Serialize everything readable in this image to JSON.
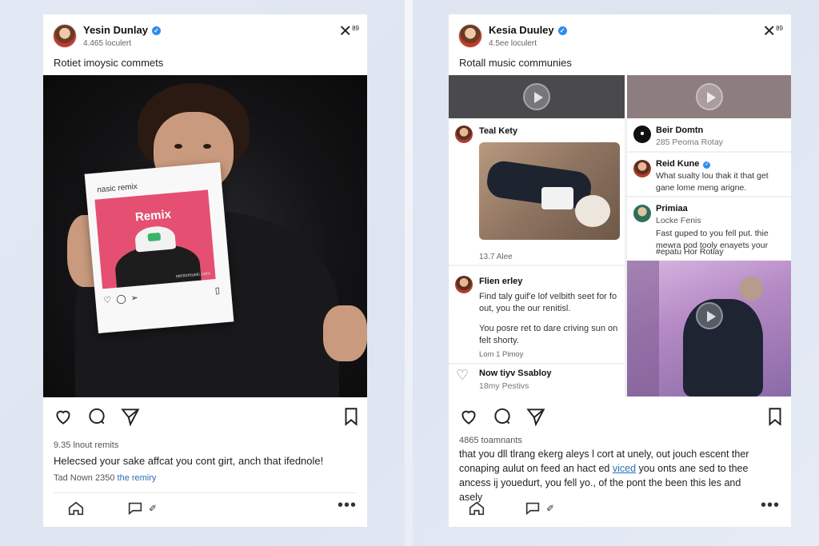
{
  "left_post": {
    "username": "Yesin Dunlay",
    "followers": "4.465 loculert",
    "caption": "Rotiet imoysic commets",
    "polaroid_title": "nasic remix",
    "remix_label": "Remix",
    "remix_small": "remixmusic.com",
    "likes": "9.35 lnout remits",
    "description": "Helecsed your sake affcat you cont girt, anch that ifednole!",
    "tag_text": "Tad Nown 2350",
    "tag_link": "the remiry",
    "close_sup": "89"
  },
  "right_post": {
    "username": "Kesia Duuley",
    "followers": "4.5ee loculert",
    "caption": "Rotall music communies",
    "close_sup": "89",
    "cards": {
      "teal": {
        "name": "Teal Kety",
        "footer": "13.7 Alee"
      },
      "beir": {
        "name": "Beir Domtn",
        "sub": "285 Peoma Rotay"
      },
      "reid": {
        "name": "Reid Kune",
        "text": "What sualty lou thak it that get gane lome meng arigne."
      },
      "primiaa": {
        "name": "Primiaa",
        "sub": "Locke Fenis",
        "text": "Fast guped to you fell put. thie mewra pod tooly enayets your",
        "hashtag": "#epatu Hor Rotiay"
      },
      "flien": {
        "name": "Flien erley",
        "text1": "Find taly guif'e lof velbith seet for fo out, you the our renitisl.",
        "text2": "You posre ret to dare criving sun on felt shorty.",
        "footer": "Lom 1 Pimoy"
      },
      "now": {
        "name": "Now tiyv Ssabloy",
        "sub": "18my Pestivs"
      }
    },
    "likes": "4865 toamnants",
    "desc_line1": "that you dll tlrang ekerg aleys l cort at unely, out jouch escent ther",
    "desc_line2a": "conaping aulut on feed an hact ed",
    "desc_link": "viced",
    "desc_line2b": "you onts ane sed to thee",
    "desc_line3": "ancess ij youedurt, you fell yo., of the pont the been this les and",
    "desc_line4": "asely"
  }
}
